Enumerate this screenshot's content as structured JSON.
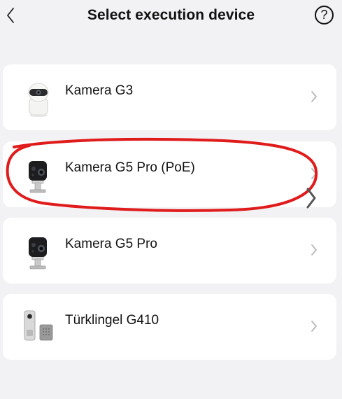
{
  "header": {
    "title": "Select execution device",
    "back_icon": "chevron-left-icon",
    "help_icon": "question-circle-icon",
    "help_glyph": "?"
  },
  "devices": [
    {
      "name": "Kamera G3",
      "icon": "indoor-pan-tilt-camera-icon"
    },
    {
      "name": "Kamera G5 Pro (PoE)",
      "icon": "outdoor-camera-icon"
    },
    {
      "name": "Kamera G5 Pro",
      "icon": "outdoor-camera-icon"
    },
    {
      "name": "Türklingel G410",
      "icon": "video-doorbell-icon"
    }
  ],
  "annotation": {
    "shape": "hand-drawn-ellipse",
    "color": "#e01b1b"
  }
}
